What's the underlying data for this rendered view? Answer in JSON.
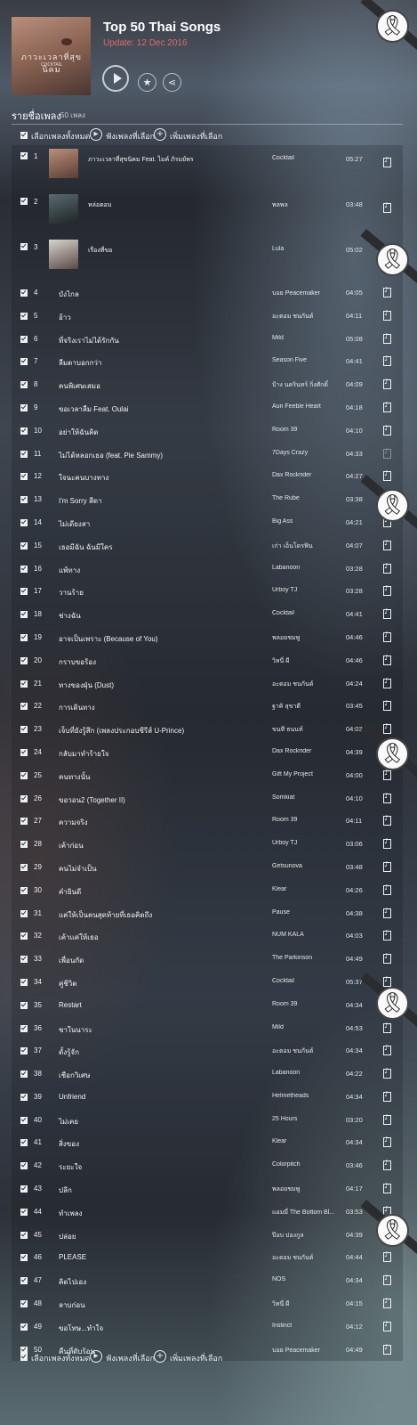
{
  "header": {
    "cover_title": "ภาวะเวลาที่สุขนิคม",
    "cover_subtitle": "COCKTAIL",
    "title": "Top 50 Thai Songs",
    "update": "Update: 12 Dec 2016",
    "play_icon": "play-icon",
    "star_icon": "star-icon",
    "share_icon": "share-icon"
  },
  "list": {
    "title": "รายชื่อเพลง",
    "count": "50 เพลง",
    "select_all": "เลือกเพลงทั้งหมด",
    "play_selected": "ฟังเพลงที่เลือก",
    "add_selected": "เพิ่มเพลงที่เลือก"
  },
  "colors": {
    "update_red": "#e06a6a",
    "ribbon_dark": "#2a2c30"
  },
  "songs": [
    {
      "num": "1",
      "name": "ภาวะเวลาที่สุขนิคม Feat. ไมค์ ภิรมย์พร",
      "artist": "Cocktail",
      "time": "05:27"
    },
    {
      "num": "2",
      "name": "หล่อตอบ",
      "artist": "พลพล",
      "time": "03:48"
    },
    {
      "num": "3",
      "name": "เรื่องที่ขอ",
      "artist": "Lula",
      "time": "05:02"
    },
    {
      "num": "4",
      "name": "บังไกล",
      "artist": "บอย Peacemaker",
      "time": "04:05"
    },
    {
      "num": "5",
      "name": "อ้าว",
      "artist": "อะตอม ชนกันต์",
      "time": "04:11"
    },
    {
      "num": "6",
      "name": "ที่จริงเราไม่ได้รักกัน",
      "artist": "Mild",
      "time": "05:08"
    },
    {
      "num": "7",
      "name": "ลืมตาบอกกว่า",
      "artist": "Season Five",
      "time": "04:41"
    },
    {
      "num": "8",
      "name": "คนพิเศษเสมอ",
      "artist": "ป้าง นครินทร์ กิ่งศักดิ์",
      "time": "04:09"
    },
    {
      "num": "9",
      "name": "ขอเวลาลืม Feat. Oulai",
      "artist": "Aun Feeble Heart",
      "time": "04:18"
    },
    {
      "num": "10",
      "name": "อย่าให้ฉันคิด",
      "artist": "Room 39",
      "time": "04:10"
    },
    {
      "num": "11",
      "name": "ไม่ได้หลอกเธอ (feat. Pie Sammy)",
      "artist": "7Days Crazy",
      "time": "04:33"
    },
    {
      "num": "12",
      "name": "ใจนะคนบางทาง",
      "artist": "Dax Rockrider",
      "time": "04:27"
    },
    {
      "num": "13",
      "name": "I'm Sorry สีดา",
      "artist": "The Rube",
      "time": "03:38"
    },
    {
      "num": "14",
      "name": "ไม่เดียงสา",
      "artist": "Big Ass",
      "time": "04:21"
    },
    {
      "num": "15",
      "name": "เธอมีฉัน ฉันมีใคร",
      "artist": "เก่า เอ็นโดรฟิน",
      "time": "04:07"
    },
    {
      "num": "16",
      "name": "แพ้ทาง",
      "artist": "Labanoon",
      "time": "03:28"
    },
    {
      "num": "17",
      "name": "วานร้าย",
      "artist": "Urboy TJ",
      "time": "03:28"
    },
    {
      "num": "18",
      "name": "ช่างฉัน",
      "artist": "Cocktail",
      "time": "04:41"
    },
    {
      "num": "19",
      "name": "อาจเป็นเพราะ (Because of You)",
      "artist": "พลอยชมพู",
      "time": "04:46"
    },
    {
      "num": "20",
      "name": "กราบขอร้อง",
      "artist": "วิหนี่ ผี",
      "time": "04:46"
    },
    {
      "num": "21",
      "name": "ทางของฝุ่น (Dust)",
      "artist": "อะตอม ชนกันต์",
      "time": "04:24"
    },
    {
      "num": "22",
      "name": "การเดินทาง",
      "artist": "ฐาคิ สุขาดี",
      "time": "03:45"
    },
    {
      "num": "23",
      "name": "เจ็บที่ยังรู้สึก (เพลงประกอบซีรีส์ U-Prince)",
      "artist": "ขนที ธนนท์",
      "time": "04:03"
    },
    {
      "num": "24",
      "name": "กลับมาทำร้ายใจ",
      "artist": "Dax Rockrider",
      "time": "04:39"
    },
    {
      "num": "25",
      "name": "คนทางนั้น",
      "artist": "Gift My Project",
      "time": "04:00"
    },
    {
      "num": "26",
      "name": "ขอวอน2 (Together II)",
      "artist": "Somkiat",
      "time": "04:10"
    },
    {
      "num": "27",
      "name": "ความจริง",
      "artist": "Room 39",
      "time": "04:11"
    },
    {
      "num": "28",
      "name": "เค้าก่อน",
      "artist": "Urboy TJ",
      "time": "03:06"
    },
    {
      "num": "29",
      "name": "คนไม่จำเป็น",
      "artist": "Getsunova",
      "time": "03:48"
    },
    {
      "num": "30",
      "name": "คำยินดี",
      "artist": "Klear",
      "time": "04:26"
    },
    {
      "num": "31",
      "name": "แค่ให้เป็นคนสุดท้ายที่เธอคิดถึง",
      "artist": "Pause",
      "time": "04:38"
    },
    {
      "num": "32",
      "name": "เค้าแค่ให้เธอ",
      "artist": "NUM KALA",
      "time": "04:03"
    },
    {
      "num": "33",
      "name": "เพื่อนกัด",
      "artist": "The Parkinson",
      "time": "04:49"
    },
    {
      "num": "34",
      "name": "คู่ชีวิต",
      "artist": "Cocktail",
      "time": "05:37"
    },
    {
      "num": "35",
      "name": "Restart",
      "artist": "Room 39",
      "time": "04:34"
    },
    {
      "num": "36",
      "name": "ชาในนาระ",
      "artist": "Mild",
      "time": "04:53"
    },
    {
      "num": "37",
      "name": "ตั้งรู้จัก",
      "artist": "อะตอม ชนกันต์",
      "time": "04:34"
    },
    {
      "num": "38",
      "name": "เชือกวิเศษ",
      "artist": "Labanoon",
      "time": "04:22"
    },
    {
      "num": "39",
      "name": "Unfriend",
      "artist": "Helmetheads",
      "time": "04:34"
    },
    {
      "num": "40",
      "name": "ไม่เคย",
      "artist": "25 Hours",
      "time": "03:20"
    },
    {
      "num": "41",
      "name": "สิ่งของ",
      "artist": "Klear",
      "time": "04:34"
    },
    {
      "num": "42",
      "name": "ระยะใจ",
      "artist": "Colorpitch",
      "time": "03:46"
    },
    {
      "num": "43",
      "name": "ปลีก",
      "artist": "พลอยชมพู",
      "time": "04:17"
    },
    {
      "num": "44",
      "name": "ทำเพลง",
      "artist": "แอมมี่ The Bottom Bl...",
      "time": "03:53"
    },
    {
      "num": "45",
      "name": "ปล่อย",
      "artist": "ป๊อบ ปองกูล",
      "time": "04:39"
    },
    {
      "num": "46",
      "name": "PLEASE",
      "artist": "อะตอม ชนกันต์",
      "time": "04:44"
    },
    {
      "num": "47",
      "name": "คิดไปเอง",
      "artist": "NOS",
      "time": "04:34"
    },
    {
      "num": "48",
      "name": "ลาบก่อน",
      "artist": "วิหนี่ ผี",
      "time": "04:15"
    },
    {
      "num": "49",
      "name": "ขอโทษ...ทำใจ",
      "artist": "Instinct",
      "time": "04:12"
    },
    {
      "num": "50",
      "name": "คืนที่ดับร้อน",
      "artist": "บอย Peacemaker",
      "time": "04:49"
    }
  ]
}
